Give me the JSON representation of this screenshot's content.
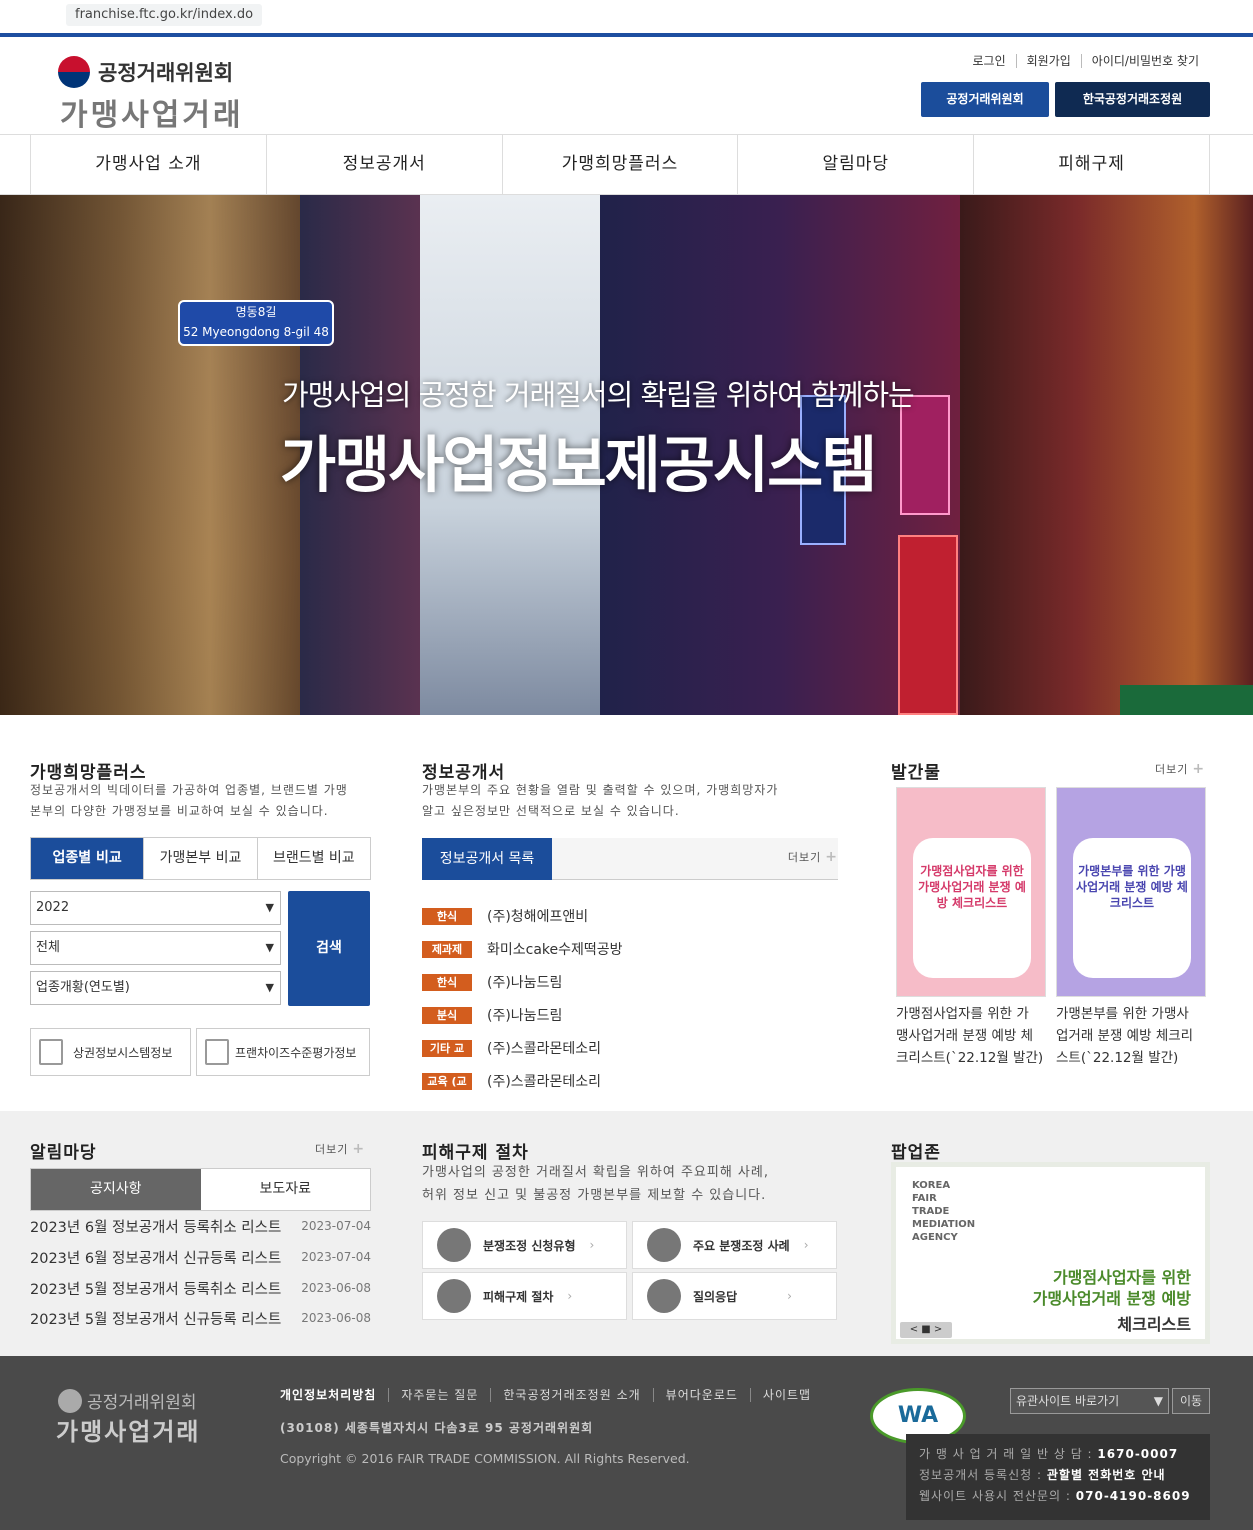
{
  "browser": {
    "url": "franchise.ftc.go.kr/index.do"
  },
  "header": {
    "org": "공정거래위원회",
    "site": "가맹사업거래",
    "util_links": [
      "로그인",
      "회원가입",
      "아이디/비밀번호 찾기"
    ],
    "btn_ftc": "공정거래위원회",
    "btn_kofair": "한국공정거래조정원"
  },
  "nav": [
    "가맹사업 소개",
    "정보공개서",
    "가맹희망플러스",
    "알림마당",
    "피해구제"
  ],
  "hero": {
    "street_sign": {
      "name": "명동8길",
      "roman": "Myeongdong 8-gil",
      "left_num": "52",
      "right_num": "48"
    },
    "subtitle": "가맹사업의 공정한 거래질서의 확립을 위하여 함께하는",
    "title": "가맹사업정보제공시스템"
  },
  "plus": {
    "title": "가맹희망플러스",
    "desc1": "정보공개서의 빅데이터를 가공하여 업종별, 브랜드별 가맹",
    "desc2": "본부의 다양한 가맹정보를 비교하여 보실 수 있습니다.",
    "tabs": [
      "업종별 비교",
      "가맹본부 비교",
      "브랜드별 비교"
    ],
    "select_year": "2022",
    "select_type": "전체",
    "select_stat": "업종개황(연도별)",
    "search_btn": "검색",
    "link1": "상권정보시스템정보",
    "link2": "프랜차이즈수준평가정보"
  },
  "info": {
    "title": "정보공개서",
    "desc1": "가맹본부의 주요 현황을 열람 및 출력할 수 있으며, 가맹희망자가",
    "desc2": "알고 싶은정보만 선택적으로 보실 수 있습니다.",
    "tab": "정보공개서 목록",
    "more": "더보기",
    "items": [
      {
        "badge": "한식",
        "name": "(주)청해에프앤비"
      },
      {
        "badge": "제과제",
        "name": "화미소cake수제떡공방"
      },
      {
        "badge": "한식",
        "name": "(주)나눔드림"
      },
      {
        "badge": "분식",
        "name": "(주)나눔드림"
      },
      {
        "badge": "기타 교",
        "name": "(주)스콜라몬테소리"
      },
      {
        "badge": "교육 (교",
        "name": "(주)스콜라몬테소리"
      }
    ]
  },
  "pub": {
    "title": "발간물",
    "more": "더보기",
    "books": [
      {
        "cover": "가맹점사업자를 위한 가맹사업거래 분쟁 예방 체크리스트",
        "caption1": "가맹점사업자를 위한 가",
        "caption2": "맹사업거래 분쟁 예방 체",
        "caption3": "크리스트(`22.12월 발간)"
      },
      {
        "cover": "가맹본부를 위한 가맹사업거래 분쟁 예방 체크리스트",
        "caption1": "가맹본부를 위한 가맹사",
        "caption2": "업거래 분쟁 예방 체크리",
        "caption3": "스트(`22.12월 발간)"
      }
    ]
  },
  "notice": {
    "title": "알림마당",
    "more": "더보기",
    "tabs": [
      "공지사항",
      "보도자료"
    ],
    "items": [
      {
        "title": "2023년 6월 정보공개서 등록취소 리스트",
        "date": "2023-07-04"
      },
      {
        "title": "2023년 6월 정보공개서 신규등록 리스트",
        "date": "2023-07-04"
      },
      {
        "title": "2023년 5월 정보공개서 등록취소 리스트",
        "date": "2023-06-08"
      },
      {
        "title": "2023년 5월 정보공개서 신규등록 리스트",
        "date": "2023-06-08"
      }
    ]
  },
  "remedy": {
    "title": "피해구제 절차",
    "desc1": "가맹사업의 공정한 거래질서 확립을 위하여 주요피해 사례,",
    "desc2": "허위 정보 신고 및 불공정 가맹본부를 제보할 수 있습니다.",
    "buttons": [
      "분쟁조정 신청유형",
      "주요 분쟁조정 사례",
      "피해구제 절차",
      "질의응답"
    ]
  },
  "popup": {
    "title": "팝업존",
    "agency": [
      "KOREA",
      "FAIR",
      "TRADE",
      "MEDIATION",
      "AGENCY"
    ],
    "line1": "가맹점사업자를 위한",
    "line2": "가맹사업거래 분쟁 예방",
    "line3": "체크리스트",
    "nav": "< ■ >"
  },
  "footer": {
    "org": "공정거래위원회",
    "site": "가맹사업거래",
    "links": [
      "개인정보처리방침",
      "자주묻는 질문",
      "한국공정거래조정원 소개",
      "뷰어다운로드",
      "사이트맵"
    ],
    "address": "(30108) 세종특별자치시 다솜3로 95 공정거래위원회",
    "copyright": "Copyright © 2016 FAIR TRADE COMMISSION. All Rights Reserved.",
    "wa": "WA",
    "related_select": "유관사이트 바로가기",
    "go_btn": "이동",
    "contact": [
      {
        "label": "가 맹 사 업 거 래 일 반 상 담 :",
        "value": "1670-0007"
      },
      {
        "label": "정보공개서 등록신청 :",
        "value": "관할별 전화번호 안내"
      },
      {
        "label": "웹사이트 사용시 전산문의 :",
        "value": "070-4190-8609"
      }
    ]
  }
}
